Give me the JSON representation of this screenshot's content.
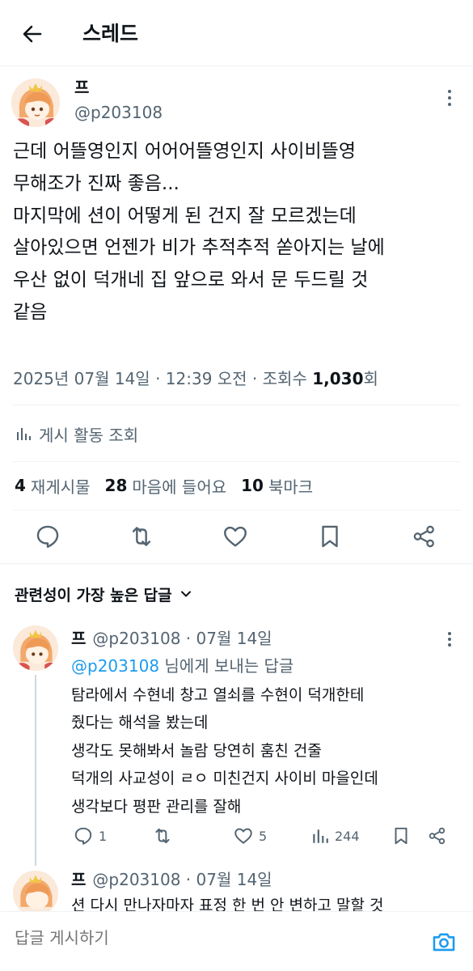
{
  "header": {
    "title": "스레드",
    "back_icon": "arrow-left-icon"
  },
  "main_post": {
    "author_name": "프",
    "handle": "@p203108",
    "body_lines": [
      "근데 어뜰영인지 어어어뜰영인지 사이비뜰영",
      "무해조가 진짜 좋음...",
      "마지막에 션이 어떻게 된 건지 잘 모르겠는데",
      "살아있으면 언젠가 비가 추적추적 쏟아지는 날에",
      "우산 없이 덕개네 집 앞으로 와서 문 두드릴 것",
      "같음"
    ],
    "meta_prefix": "2025년 07월 14일 · 12:39 오전 · 조회수 ",
    "views": "1,030",
    "views_suffix": "회",
    "analytics_label": "게시 활동 조회",
    "stats": [
      {
        "count": "4",
        "label": "재게시물"
      },
      {
        "count": "28",
        "label": "마음에 들어요"
      },
      {
        "count": "10",
        "label": "북마크"
      }
    ]
  },
  "replies_sort_label": "관련성이 가장 높은 답글",
  "reply": {
    "author_name": "프",
    "handle_date": "@p203108 · 07월 14일",
    "reply_to_mention": "@p203108",
    "reply_to_suffix": " 님에게 보내는 답글",
    "body_lines": [
      "탐라에서 수현네 창고 열쇠를 수현이 덕개한테",
      "줬다는 해석을 봤는데",
      "생각도 못해봐서 놀람 당연히 훔친 건줄",
      "덕개의 사교성이 ㄹㅇ 미친건지 사이비 마을인데",
      "생각보다 평판 관리를 잘해"
    ],
    "replies_count": "1",
    "likes_count": "5",
    "views_count": "244"
  },
  "reply2": {
    "author_name": "프",
    "handle_date": "@p203108 · 07월 14일",
    "first_line": "션 다시 만나자마자 표정 한 번 안 변하고 말할 것"
  },
  "composer": {
    "placeholder": "답글 게시하기"
  },
  "colors": {
    "accent": "#1d9bf0",
    "secondary_text": "#536471",
    "primary_text": "#0f1419"
  }
}
